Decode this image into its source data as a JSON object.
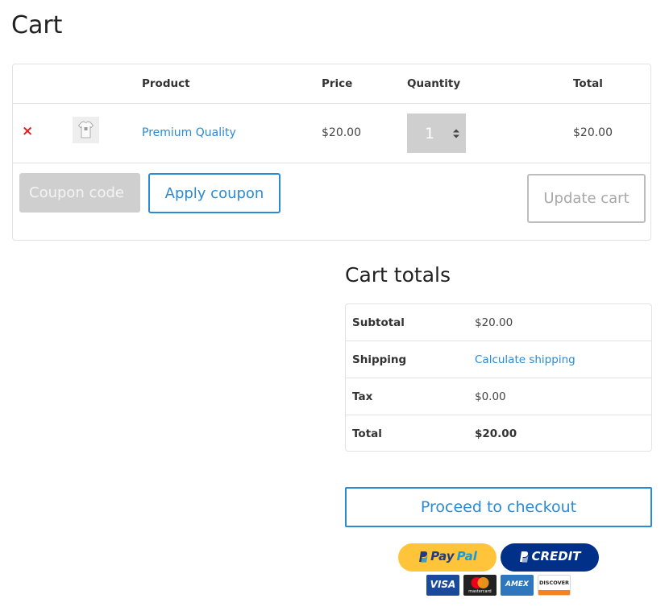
{
  "page": {
    "title": "Cart"
  },
  "cart_table": {
    "headers": {
      "product": "Product",
      "price": "Price",
      "quantity": "Quantity",
      "total": "Total"
    },
    "items": [
      {
        "remove_label": "×",
        "name": "Premium Quality",
        "price": "$20.00",
        "quantity": "1",
        "total": "$20.00",
        "thumbnail_icon": "tshirt-icon"
      }
    ]
  },
  "coupon": {
    "placeholder": "Coupon code",
    "apply_label": "Apply coupon"
  },
  "update_cart_label": "Update cart",
  "totals": {
    "title": "Cart totals",
    "rows": [
      {
        "label": "Subtotal",
        "value": "$20.00"
      },
      {
        "label": "Shipping",
        "value": "Calculate shipping"
      },
      {
        "label": "Tax",
        "value": "$0.00"
      },
      {
        "label": "Total",
        "value": "$20.00"
      }
    ]
  },
  "checkout": {
    "label": "Proceed to checkout"
  },
  "payments": {
    "paypal": {
      "part1": "Pay",
      "part2": "Pal"
    },
    "credit": {
      "label": "CREDIT"
    },
    "cards": {
      "visa": "VISA",
      "mastercard": "mastercard",
      "amex": "AMEX",
      "discover": "DISCOVER"
    }
  },
  "colors": {
    "accent": "#2a8ad4",
    "remove": "#e21d1d",
    "paypal_yellow": "#ffc439",
    "paypal_blue": "#003087"
  }
}
